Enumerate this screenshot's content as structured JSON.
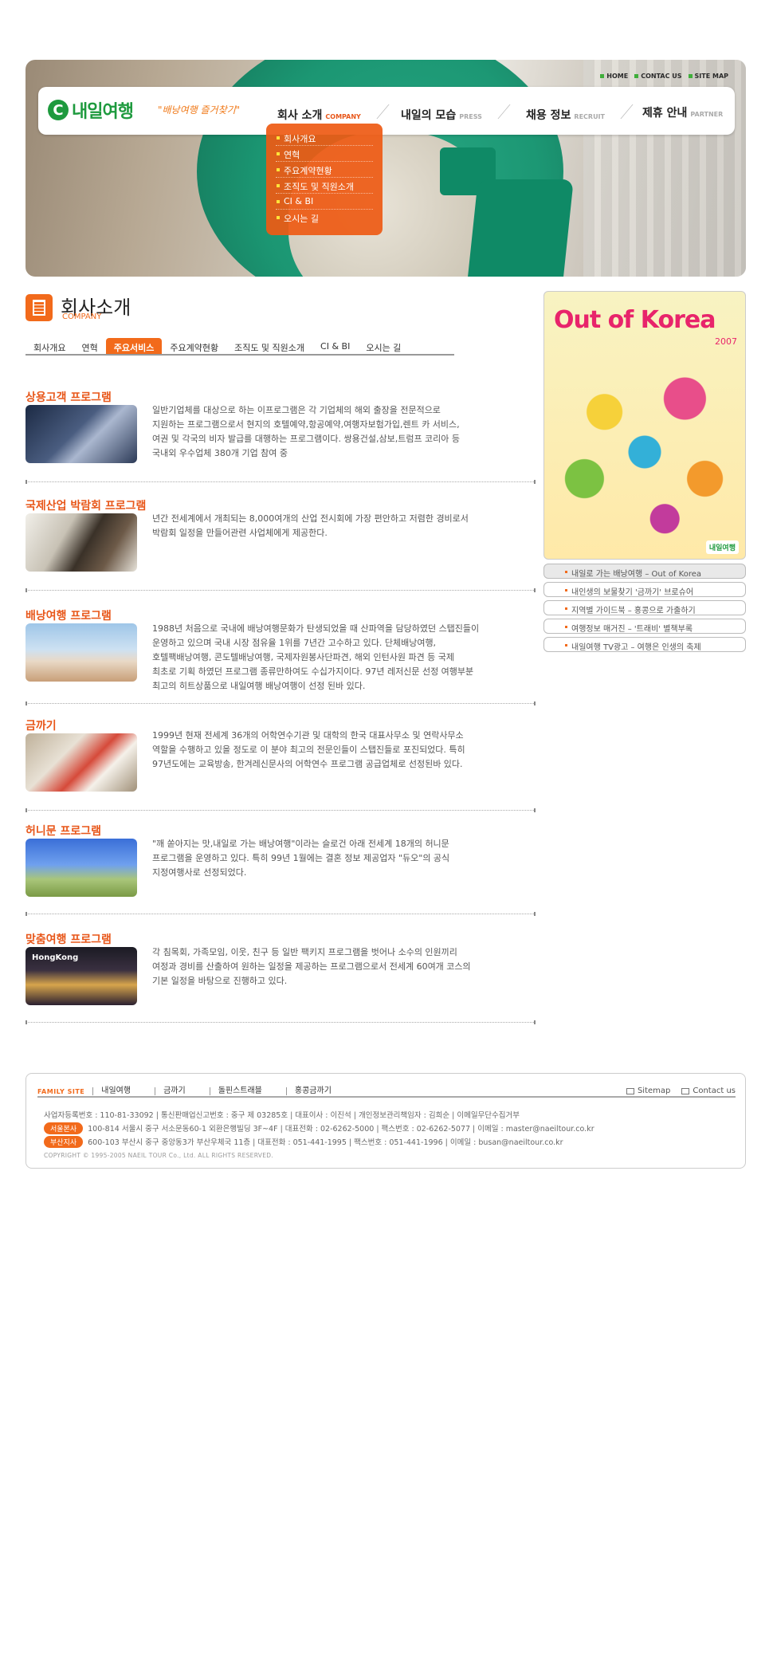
{
  "header": {
    "top_links": [
      "HOME",
      "CONTAC US",
      "SITE MAP"
    ],
    "logo_text": "내일여행",
    "slogan": "\"배낭여행 즐거찾기\"",
    "nav": [
      {
        "ko": "회사 소개",
        "en": "COMPANY"
      },
      {
        "ko": "내일의 모습",
        "en": "PRESS"
      },
      {
        "ko": "채용 정보",
        "en": "RECRUIT"
      },
      {
        "ko": "제휴 안내",
        "en": "PARTNER"
      }
    ],
    "dropdown": [
      "회사개요",
      "연혁",
      "주요계약현황",
      "조직도 및 직원소개",
      "CI & BI",
      "오시는 길"
    ]
  },
  "page": {
    "title": "회사소개",
    "subtitle": "COMPANY",
    "tabs": [
      "회사개요",
      "연혁",
      "주요서비스",
      "주요계약현황",
      "조직도 및 직원소개",
      "CI & BI",
      "오시는 길"
    ],
    "active_tab": "주요서비스"
  },
  "sections": [
    {
      "title": "상용고객 프로그램",
      "lines": [
        "일반기업체를 대상으로 하는 이프로그램은 각 기업체의 해외 출장을 전문적으로",
        "지원하는 프로그램으로서 현지의 호텔예약,항공예약,여행자보험가입,렌트 카 서비스,",
        "여권 및 각국의 비자 발급를 대행하는 프로그램이다. 쌍용건설,삼보,트럼프 코리아 등",
        "국내외 우수업체 380개 기업 참여 중"
      ]
    },
    {
      "title": "국제산업 박람회 프로그램",
      "lines": [
        "년간 전세계에서 개최되는 8,000여개의 산업 전시회에 가장 편안하고 저렴한 경비로서",
        "박람회 일정을 만들어관련 사업체에게 제공한다."
      ]
    },
    {
      "title": "배낭여행 프로그램",
      "lines": [
        "1988년 처음으로 국내에 배낭여행문화가 탄생되었을 때 산파역을 담당하였던 스탭진들이",
        "운영하고 있으며 국내 시장 점유율 1위를 7년간 고수하고 있다. 단체배낭여행,",
        "호텔팩배낭여행, 콘도텔배낭여행, 국제자원봉사단파견, 해외 인턴사원 파견 등 국제",
        "최초로 기획 하였던 프로그램 종류만하여도 수십가지이다. 97년 레저신문 선정 여행부분",
        "최고의 히트상품으로 내일여행 배낭여행이 선정 된바 있다."
      ]
    },
    {
      "title": "금까기",
      "lines": [
        "1999년 현재 전세계 36개의 어학연수기관 및 대학의 한국 대표사무소 및 연락사무소",
        "역할을 수행하고 있을 정도로 이 분야 최고의 전문인들이 스탭진들로 포진되었다. 특히",
        "97년도에는 교육방송, 한겨레신문사의 어학연수 프로그램 공급업체로 선정된바 있다."
      ]
    },
    {
      "title": "허니문 프로그램",
      "lines": [
        "\"깨 쏟아지는 맛,내일로 가는 배낭여행\"이라는 슬로건 아래 전세계 18개의 허니문",
        "프로그램을 운영하고 있다. 특히 99년 1월에는 결혼 정보 제공업자 \"듀오\"의 공식",
        "지정여행사로 선정되었다."
      ]
    },
    {
      "title": "맞춤여행 프로그램",
      "lines": [
        "각 침목회, 가족모임, 이웃, 친구 등 일반 팩키지 프로그램을 벗어나 소수의 인원끼리",
        "여정과 경비를 산출하여 원하는 일정을 제공하는 프로그램으로서 전세계 60여개 코스의",
        "기본 일정을 바탕으로 진행하고 있다."
      ]
    }
  ],
  "thumb_labels": {
    "hongkong": "HongKong"
  },
  "sidebar": {
    "poster_title": "Out of Korea",
    "poster_year": "2007",
    "poster_logo": "내일여행",
    "links": [
      "내일로 가는 배낭여행 – Out of Korea",
      "내인생의 보물찾기 '금까기' 브로슈어",
      "지역별 가이드북 – 홍콩으로 가출하기",
      "여행정보 매거진 – '트래비' 별책부록",
      "내일여행 TV광고 – 여행은 인생의 축제"
    ]
  },
  "footer": {
    "family_label": "FAMILY SITE",
    "family_sites": [
      "내일여행",
      "금까기",
      "돌핀스트래블",
      "홍콩금까기"
    ],
    "links": [
      "Sitemap",
      "Contact us"
    ],
    "info_line": "사업자등록번호 : 110-81-33092 | 통신판매업신고번호 : 중구 제 03285호 | 대표이사 : 이진석 | 개인정보관리책임자 : 김희순 | 이메일무단수집거부",
    "seoul_badge": "서울본사",
    "seoul_line": "100-814 서울시 중구 서소문동60-1 외환은행빌딩 3F~4F | 대표전화 : 02-6262-5000 | 팩스번호 : 02-6262-5077 | 이메일 : master@naeiltour.co.kr",
    "busan_badge": "부산지사",
    "busan_line": "600-103 부산시 중구 중앙동3가 부산우체국 11층 | 대표전화 : 051-441-1995 | 팩스번호 : 051-441-1996 | 이메일 : busan@naeiltour.co.kr",
    "copyright": "COPYRIGHT © 1995-2005 NAEIL TOUR Co., Ltd. ALL RIGHTS RESERVED."
  }
}
